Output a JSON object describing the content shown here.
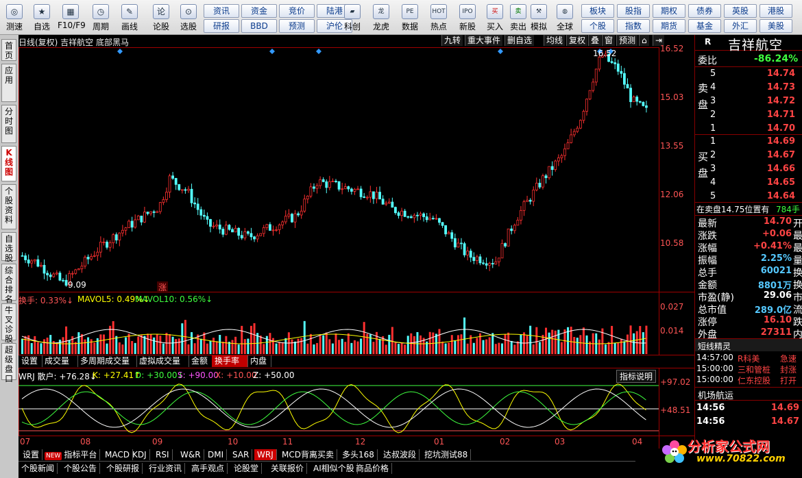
{
  "toolbar": {
    "buttons": [
      {
        "label": "测速",
        "icon": "speed-icon",
        "glyph": "◎"
      },
      {
        "label": "自选",
        "icon": "star-icon",
        "glyph": "★"
      },
      {
        "label": "F10/F9",
        "icon": "f10-icon",
        "glyph": "▦"
      },
      {
        "label": "周期",
        "icon": "clock-icon",
        "glyph": "◷"
      },
      {
        "label": "画线",
        "icon": "pencil-icon",
        "glyph": "✎"
      },
      {
        "label": "论股",
        "icon": "comment-icon",
        "glyph": "论"
      },
      {
        "label": "选股",
        "icon": "select-stock-icon",
        "glyph": "⊙"
      }
    ],
    "pills_row1": [
      "资讯",
      "资金",
      "竞价",
      "陆港"
    ],
    "pills_row2": [
      "研报",
      "BBD",
      "预测",
      "沪伦"
    ],
    "buttons2": [
      {
        "label": "科创",
        "icon": "chart-icon",
        "glyph": "▰"
      },
      {
        "label": "龙虎",
        "icon": "dragon-icon",
        "glyph": "龙"
      },
      {
        "label": "数据",
        "icon": "pe-icon",
        "glyph": "PE"
      },
      {
        "label": "热点",
        "icon": "hot-icon",
        "glyph": "HOT"
      },
      {
        "label": "新股",
        "icon": "ipo-icon",
        "glyph": "IPO"
      },
      {
        "label": "买入",
        "icon": "buy-icon",
        "glyph": "买"
      },
      {
        "label": "卖出",
        "icon": "sell-icon",
        "glyph": "卖"
      },
      {
        "label": "模拟",
        "icon": "hammer-icon",
        "glyph": "⚒"
      },
      {
        "label": "全球",
        "icon": "globe-icon",
        "glyph": "◍"
      }
    ],
    "pills2_row1": [
      "板块",
      "股指",
      "期权",
      "债券",
      "英股",
      "港股"
    ],
    "pills2_row2": [
      "个股",
      "指数",
      "期货",
      "基金",
      "外汇",
      "美股"
    ]
  },
  "leftnav": [
    "首页",
    "应用",
    "分时图",
    "K线图",
    "个股资料",
    "自选股",
    "综合排名",
    "牛叉诊股",
    "超级盘口"
  ],
  "chart": {
    "title": "日线(复权) 吉祥航空 底部黑马",
    "tools": [
      "九转",
      "重大事件",
      "删自选",
      "均线",
      "复权",
      "叠",
      "窗",
      "预测",
      "⌂",
      "⇥"
    ],
    "price_axis": [
      "16.52",
      "15.03",
      "13.55",
      "12.06",
      "10.58"
    ],
    "high_label": "16.52",
    "low_label": "9.09",
    "zhang_label": "涨",
    "turnover": {
      "label1": "换手: 0.33%↓",
      "label2": "MAVOL5: 0.49%↓",
      "label3": "MAVOL10: 0.56%↓",
      "axis": [
        "0.027",
        "0.014"
      ]
    },
    "mid_tabs": [
      "设置",
      "成交量",
      "多周期成交量",
      "虚拟成交量",
      "金额",
      "换手率",
      "内盘"
    ],
    "mid_active": "换手率",
    "wrj": {
      "name": "WRJ 散户: +76.28↓",
      "k": "K: +27.41↑",
      "d": "D: +30.00↓",
      "s": "S: +90.00",
      "x": "X: +10.00",
      "z": "Z: +50.00",
      "explain": "指标说明",
      "axis": [
        "+97.02",
        "+48.51"
      ]
    },
    "months": [
      "07",
      "08",
      "09",
      "10",
      "11",
      "12",
      "01",
      "02",
      "03",
      "04"
    ]
  },
  "bottom_tabs1": [
    "设置",
    "指标平台",
    "MACD",
    "KDJ",
    "RSI",
    "W&R",
    "DMI",
    "SAR",
    "WRJ",
    "MCD背离买卖",
    "多头168",
    "达叔波段",
    "挖坑测试88"
  ],
  "bottom_new_badge": "NEW",
  "bottom_active": "WRJ",
  "bottom_tabs2": [
    "个股新闻",
    "个股公告",
    "个股研报",
    "行业资讯",
    "高手观点",
    "论股堂",
    "关联报价",
    "AI相似个股",
    "商品价格"
  ],
  "right": {
    "code_marker": "R",
    "name": "吉祥航空",
    "weibi_label": "委比",
    "weibi_value": "-86.24%",
    "sell_label": "卖盘",
    "buy_label": "买盘",
    "sell": [
      {
        "i": "5",
        "p": "14.74"
      },
      {
        "i": "4",
        "p": "14.73"
      },
      {
        "i": "3",
        "p": "14.72"
      },
      {
        "i": "2",
        "p": "14.71"
      },
      {
        "i": "1",
        "p": "14.70"
      }
    ],
    "buy": [
      {
        "i": "1",
        "p": "14.69"
      },
      {
        "i": "2",
        "p": "14.67"
      },
      {
        "i": "3",
        "p": "14.66"
      },
      {
        "i": "4",
        "p": "14.65"
      },
      {
        "i": "5",
        "p": "14.64"
      }
    ],
    "notice": "在卖盘14.75位置有",
    "notice_vol": "784手",
    "quotes": [
      {
        "l": "最新",
        "v": "14.70",
        "c": "#ff4444",
        "t": "开"
      },
      {
        "l": "涨跌",
        "v": "+0.06",
        "c": "#ff4444",
        "t": "最"
      },
      {
        "l": "涨幅",
        "v": "+0.41%",
        "c": "#ff4444",
        "t": "最"
      },
      {
        "l": "振幅",
        "v": "2.25%",
        "c": "#55c8ff",
        "t": "量"
      },
      {
        "l": "总手",
        "v": "60021",
        "c": "#55c8ff",
        "t": "换"
      },
      {
        "l": "金额",
        "v": "8801万",
        "c": "#55c8ff",
        "t": "换"
      },
      {
        "l": "市盈(静)",
        "v": "29.06",
        "c": "#ffffff",
        "t": "市"
      },
      {
        "l": "总市值",
        "v": "289.0亿",
        "c": "#55c8ff",
        "t": "流"
      },
      {
        "l": "涨停",
        "v": "16.10",
        "c": "#ff4444",
        "t": "跌"
      },
      {
        "l": "外盘",
        "v": "27311",
        "c": "#ff4444",
        "t": "内"
      }
    ],
    "short_title": "短线精灵",
    "short_items": [
      {
        "t": "14:57:00",
        "n": "R科美",
        "s": "急速"
      },
      {
        "t": "15:00:00",
        "n": "三和管桩",
        "s": "封涨"
      },
      {
        "t": "15:00:00",
        "n": "仁东控股",
        "s": "打开"
      }
    ],
    "market_title": "机场航运",
    "ticks": [
      {
        "t": "14:56",
        "p": "14.69"
      },
      {
        "t": "14:56",
        "p": "14.67"
      }
    ]
  },
  "logo": {
    "text": "分析家公式网",
    "url": "www.70822.com"
  },
  "chart_data": {
    "type": "candlestick",
    "title": "日线(复权) 吉祥航空 底部黑马",
    "price_range": [
      9.09,
      16.52
    ],
    "high": 16.52,
    "low": 9.09,
    "x_months": [
      "07",
      "08",
      "09",
      "10",
      "11",
      "12",
      "01",
      "02",
      "03",
      "04"
    ]
  },
  "colors": {
    "up": "#ff3030",
    "down": "#54ffff",
    "ma5": "#ffffff",
    "ma10": "#ffff00",
    "k": "#ffff00",
    "d": "#3fff3f",
    "s_line": "#ffffff",
    "x_line": "#ffffff"
  }
}
